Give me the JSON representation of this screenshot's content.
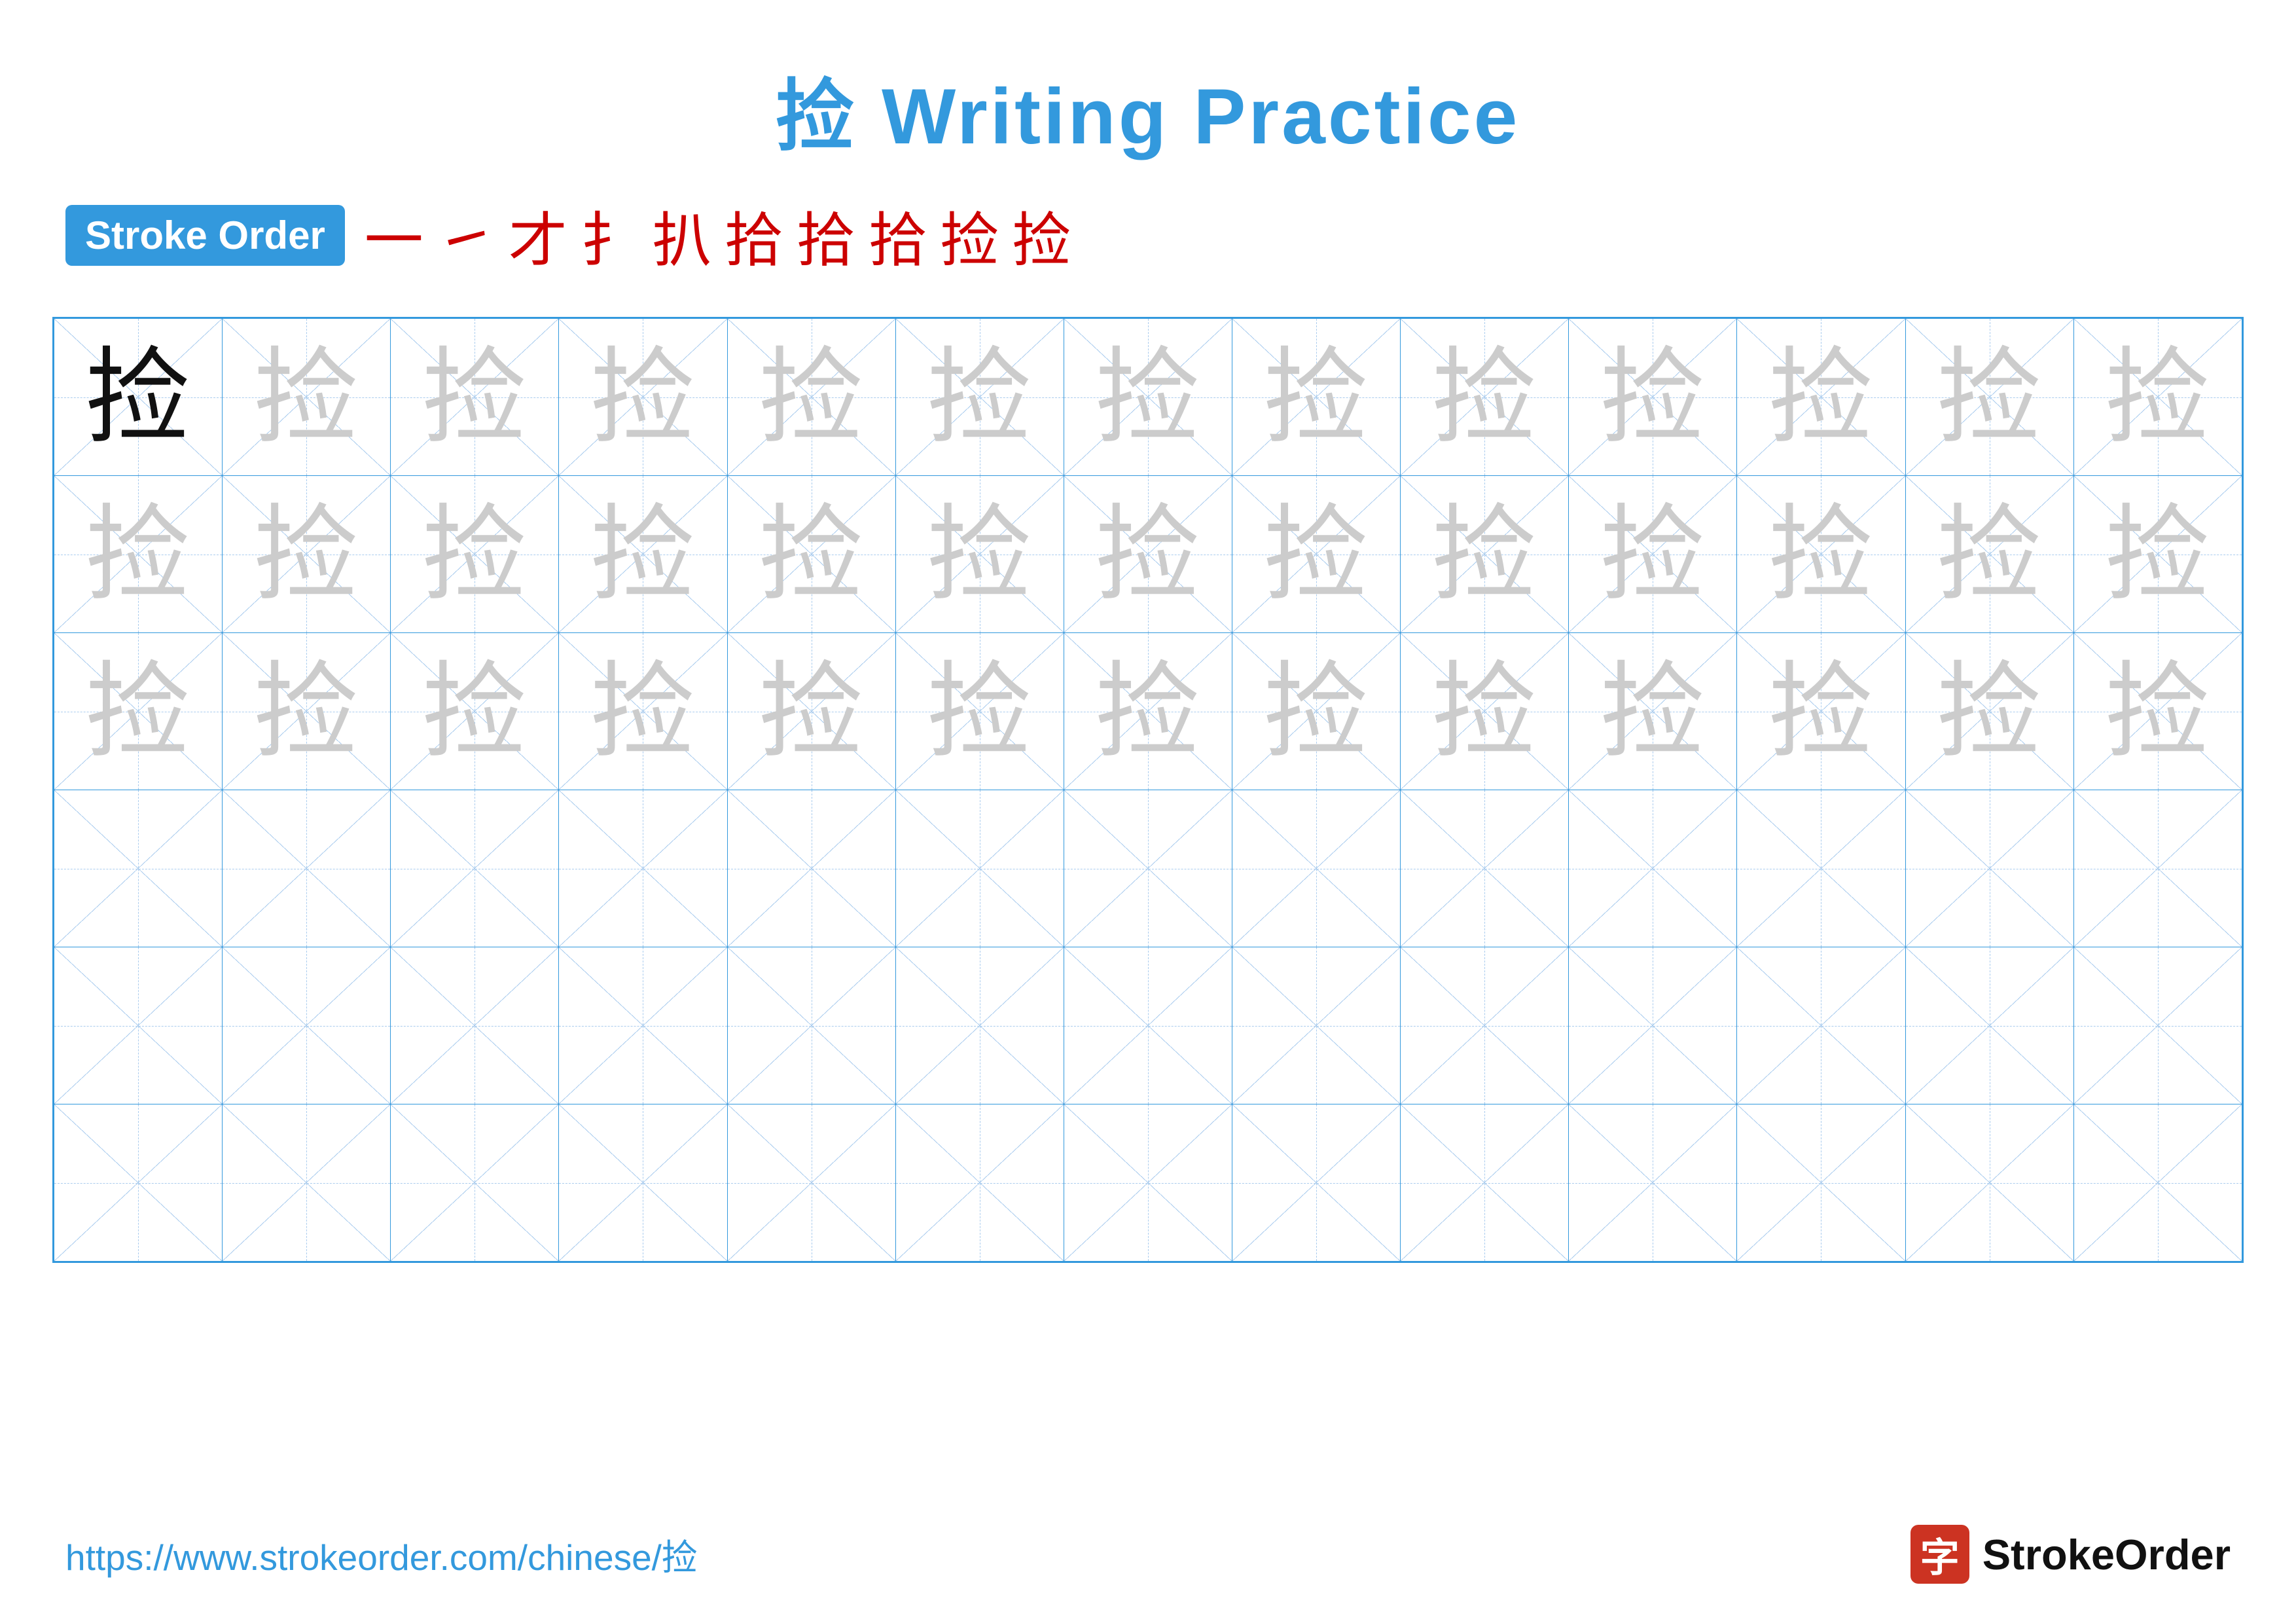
{
  "title": "捡 Writing Practice",
  "stroke_order": {
    "label": "Stroke Order",
    "strokes": [
      "一",
      "㇀",
      "才",
      "扌",
      "扒",
      "拾",
      "拾",
      "拾",
      "捡",
      "捡"
    ]
  },
  "character": "捡",
  "rows": [
    {
      "type": "mixed",
      "cells": [
        "solid",
        "faded",
        "faded",
        "faded",
        "faded",
        "faded",
        "faded",
        "faded",
        "faded",
        "faded",
        "faded",
        "faded",
        "faded"
      ]
    },
    {
      "type": "faded",
      "cells": [
        "faded",
        "faded",
        "faded",
        "faded",
        "faded",
        "faded",
        "faded",
        "faded",
        "faded",
        "faded",
        "faded",
        "faded",
        "faded"
      ]
    },
    {
      "type": "faded",
      "cells": [
        "faded",
        "faded",
        "faded",
        "faded",
        "faded",
        "faded",
        "faded",
        "faded",
        "faded",
        "faded",
        "faded",
        "faded",
        "faded"
      ]
    },
    {
      "type": "empty",
      "cells": [
        "",
        "",
        "",
        "",
        "",
        "",
        "",
        "",
        "",
        "",
        "",
        "",
        ""
      ]
    },
    {
      "type": "empty",
      "cells": [
        "",
        "",
        "",
        "",
        "",
        "",
        "",
        "",
        "",
        "",
        "",
        "",
        ""
      ]
    },
    {
      "type": "empty",
      "cells": [
        "",
        "",
        "",
        "",
        "",
        "",
        "",
        "",
        "",
        "",
        "",
        "",
        ""
      ]
    }
  ],
  "footer": {
    "url": "https://www.strokeorder.com/chinese/捡",
    "logo_char": "字",
    "logo_text": "StrokeOrder"
  },
  "colors": {
    "blue": "#3399dd",
    "red": "#cc0000",
    "light_blue": "#aaccee",
    "faded_char": "#cccccc"
  }
}
